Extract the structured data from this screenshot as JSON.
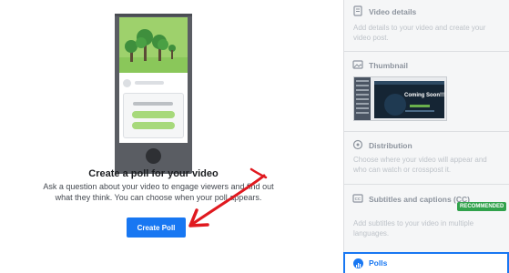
{
  "main": {
    "headline": "Create a poll for your video",
    "description": "Ask a question about your video to engage viewers and find out what they think. You can choose when your poll appears.",
    "create_button": "Create Poll"
  },
  "sidebar": {
    "video_details": {
      "title": "Video details",
      "description": "Add details to your video and create your video post.",
      "icon": "document-icon"
    },
    "thumbnail": {
      "title": "Thumbnail",
      "icon": "image-icon",
      "preview_text": "Coming Soon!!!"
    },
    "distribution": {
      "title": "Distribution",
      "description": "Choose where your video will appear and who can watch or crosspost it.",
      "icon": "distribution-icon"
    },
    "subtitles": {
      "title": "Subtitles and captions (CC)",
      "badge": "RECOMMENDED",
      "description": "Add subtitles to your video in multiple languages.",
      "icon": "cc-icon"
    },
    "polls": {
      "title": "Polls",
      "icon": "poll-icon"
    }
  },
  "colors": {
    "accent": "#1877f2",
    "badge": "#31a24c",
    "arrow": "#e0191f",
    "sidebar_bg": "#f5f6f7"
  }
}
